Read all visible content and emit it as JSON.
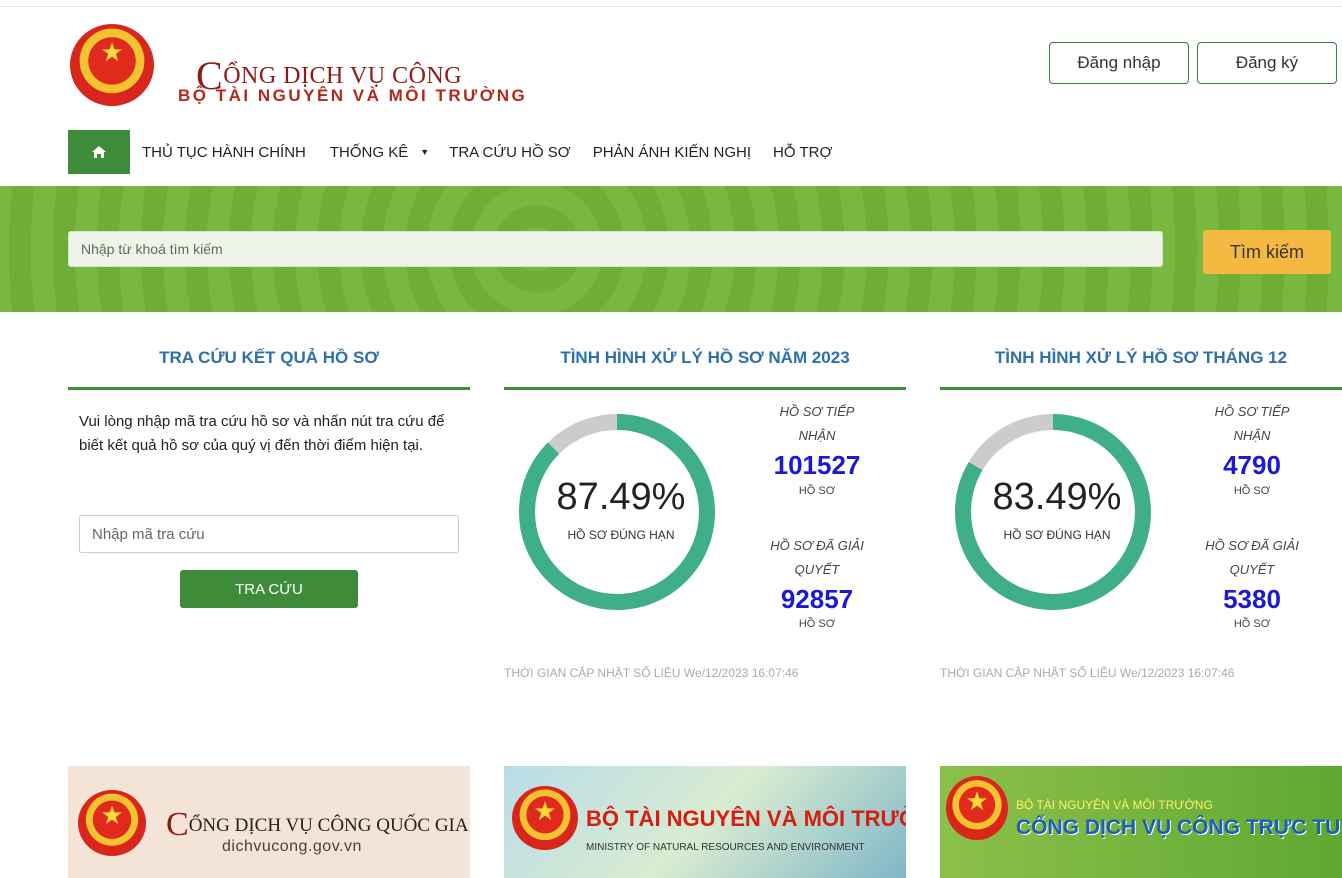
{
  "header": {
    "logo_title": "CỔNG DỊCH VỤ CÔNG",
    "logo_initial": "C",
    "logo_rest": "ỔNG DỊCH VỤ CÔNG",
    "logo_subtitle": "BỘ TÀI NGUYÊN VÀ MÔI TRƯỜNG",
    "login_label": "Đăng nhập",
    "register_label": "Đăng ký"
  },
  "nav": {
    "home_icon": "home-icon",
    "items": [
      {
        "label": "THỦ TỤC HÀNH CHÍNH"
      },
      {
        "label": "THỐNG KÊ",
        "dropdown": true
      },
      {
        "label": "TRA CỨU HỒ SƠ"
      },
      {
        "label": "PHẢN ÁNH KIẾN NGHỊ"
      },
      {
        "label": "HỖ TRỢ"
      }
    ]
  },
  "search": {
    "placeholder": "Nhập từ khoá tìm kiếm",
    "button_label": "Tìm kiếm"
  },
  "lookup": {
    "title": "TRA CỨU KẾT QUẢ HỒ SƠ",
    "description": "Vui lòng nhập mã tra cứu hồ sơ và nhấn nút tra cứu để biết kết quả hồ sơ của quý vị đến thời điểm hiện tại.",
    "input_placeholder": "Nhập mã tra cứu",
    "button_label": "TRA CỨU"
  },
  "stats": [
    {
      "title": "TÌNH HÌNH XỬ LÝ HỒ SƠ NĂM 2023",
      "percent_text": "87.49%",
      "percent_value": 87.49,
      "percent_label": "HỒ SƠ ĐÚNG HẠN",
      "received_label_1": "HỒ SƠ TIẾP",
      "received_label_2": "NHẬN",
      "received_value": "101527",
      "received_unit": "HỒ SƠ",
      "resolved_label_1": "HỒ SƠ ĐÃ GIẢI",
      "resolved_label_2": "QUYẾT",
      "resolved_value": "92857",
      "resolved_unit": "HỒ SƠ",
      "updated": "THỜI GIAN CẬP NHẬT SỐ LIỆU We/12/2023 16:07:46"
    },
    {
      "title": "TÌNH HÌNH XỬ LÝ HỒ SƠ THÁNG 12",
      "percent_text": "83.49%",
      "percent_value": 83.49,
      "percent_label": "HỒ SƠ ĐÚNG HẠN",
      "received_label_1": "HỒ SƠ TIẾP",
      "received_label_2": "NHẬN",
      "received_value": "4790",
      "received_unit": "HỒ SƠ",
      "resolved_label_1": "HỒ SƠ ĐÃ GIẢI",
      "resolved_label_2": "QUYẾT",
      "resolved_value": "5380",
      "resolved_unit": "HỒ SƠ",
      "updated": "THỜI GIAN CẬP NHẬT SỐ LIỆU We/12/2023 16:07:46"
    }
  ],
  "cards": {
    "c1_initial": "C",
    "c1_title_rest": "ỔNG DỊCH VỤ CÔNG QUỐC GIA",
    "c1_url": "dichvucong.gov.vn",
    "c2_title": "BỘ TÀI NGUYÊN VÀ MÔI TRƯỜNG",
    "c2_subtitle": "MINISTRY OF NATURAL RESOURCES AND ENVIRONMENT",
    "c3_line1": "BỘ TÀI NGUYÊN VÀ MÔI TRƯỜNG",
    "c3_line2": "CỔNG DỊCH VỤ CÔNG TRỰC TUYẾN"
  },
  "colors": {
    "brand_green": "#3e8c3a",
    "title_blue": "#2e6fae",
    "number_blue": "#1b18d6",
    "ring_green": "#3fae8a",
    "ring_grey": "#cccccc",
    "search_button": "#f5b942"
  }
}
